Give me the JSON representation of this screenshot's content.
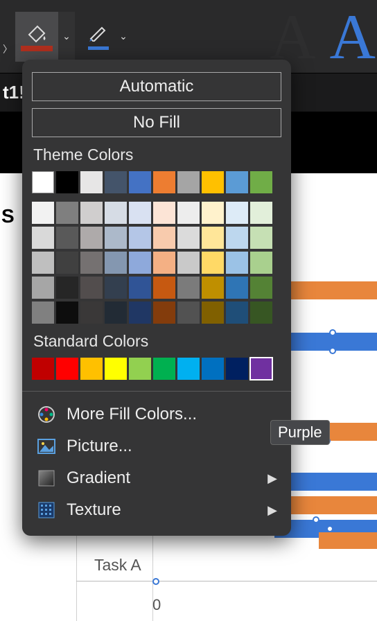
{
  "toolbar": {
    "fill_color": "#b02f1e",
    "outline_color": "#3a78d6",
    "big_a_dark": "A",
    "big_a_blue": "A",
    "big_a_dark_color": "#2e2e2f",
    "big_a_blue_color": "#3a78d6"
  },
  "sheet_tab": "t1!",
  "row_label_s": "S",
  "panel": {
    "automatic": "Automatic",
    "no_fill": "No Fill",
    "theme_label": "Theme Colors",
    "standard_label": "Standard Colors",
    "more_colors": "More Fill Colors...",
    "picture": "Picture...",
    "gradient": "Gradient",
    "texture": "Texture",
    "theme_main": [
      "#ffffff",
      "#000000",
      "#e7e6e6",
      "#44546a",
      "#4472c4",
      "#ed7d31",
      "#a5a5a5",
      "#ffc000",
      "#5b9bd5",
      "#70ad47"
    ],
    "theme_tints": [
      [
        "#f2f2f2",
        "#7f7f7f",
        "#d0cece",
        "#d6dce5",
        "#d9e1f2",
        "#fce4d6",
        "#ededed",
        "#fff2cc",
        "#ddebf7",
        "#e2efda"
      ],
      [
        "#d9d9d9",
        "#595959",
        "#aeaaaa",
        "#acb9ca",
        "#b4c6e7",
        "#f8cbad",
        "#dbdbdb",
        "#ffe699",
        "#bdd7ee",
        "#c6e0b4"
      ],
      [
        "#bfbfbf",
        "#404040",
        "#757171",
        "#8497b0",
        "#8ea9db",
        "#f4b084",
        "#c9c9c9",
        "#ffd966",
        "#9bc2e6",
        "#a9d08e"
      ],
      [
        "#a6a6a6",
        "#262626",
        "#524d4d",
        "#333f4f",
        "#305496",
        "#c65911",
        "#7b7b7b",
        "#bf8f00",
        "#2f75b5",
        "#548235"
      ],
      [
        "#808080",
        "#0d0d0d",
        "#3a3838",
        "#222b35",
        "#203764",
        "#833c0c",
        "#525252",
        "#806000",
        "#1f4e78",
        "#375623"
      ]
    ],
    "standard_colors": [
      "#c00000",
      "#ff0000",
      "#ffc000",
      "#ffff00",
      "#92d050",
      "#00b050",
      "#00b0f0",
      "#0070c0",
      "#002060",
      "#7030a0"
    ],
    "selected_standard_index": 9
  },
  "tooltip": "Purple",
  "chart": {
    "task_label": "Task A",
    "axis_tick": "0"
  }
}
